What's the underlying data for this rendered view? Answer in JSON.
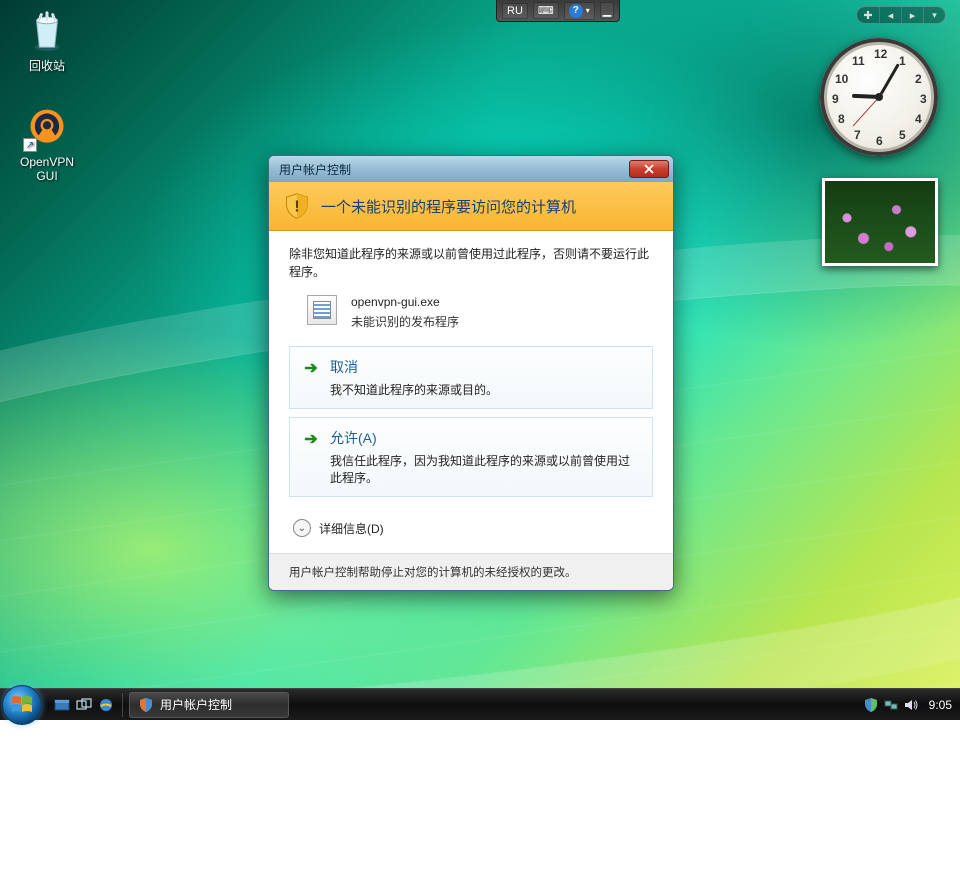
{
  "desktop_icons": {
    "recycle_bin": "回收站",
    "openvpn": "OpenVPN GUI"
  },
  "language_bar": {
    "lang": "RU"
  },
  "clock_gadget": {
    "numbers": {
      "n12": "12",
      "n1": "1",
      "n2": "2",
      "n3": "3",
      "n4": "4",
      "n5": "5",
      "n6": "6",
      "n7": "7",
      "n8": "8",
      "n9": "9",
      "n10": "10",
      "n11": "11"
    },
    "time": {
      "hour": 9,
      "minute": 5,
      "second": 37
    }
  },
  "uac": {
    "title": "用户帐户控制",
    "header": "一个未能识别的程序要访问您的计算机",
    "explain": "除非您知道此程序的来源或以前曾使用过此程序，否则请不要运行此程序。",
    "program": {
      "name": "openvpn-gui.exe",
      "publisher": "未能识别的发布程序"
    },
    "cancel": {
      "title": "取消",
      "desc": "我不知道此程序的来源或目的。"
    },
    "allow": {
      "title": "允许(A)",
      "desc": "我信任此程序，因为我知道此程序的来源或以前曾使用过此程序。"
    },
    "details": "详细信息(D)",
    "footer": "用户帐户控制帮助停止对您的计算机的未经授权的更改。"
  },
  "taskbar": {
    "active_task": "用户帐户控制",
    "clock": "9:05"
  }
}
